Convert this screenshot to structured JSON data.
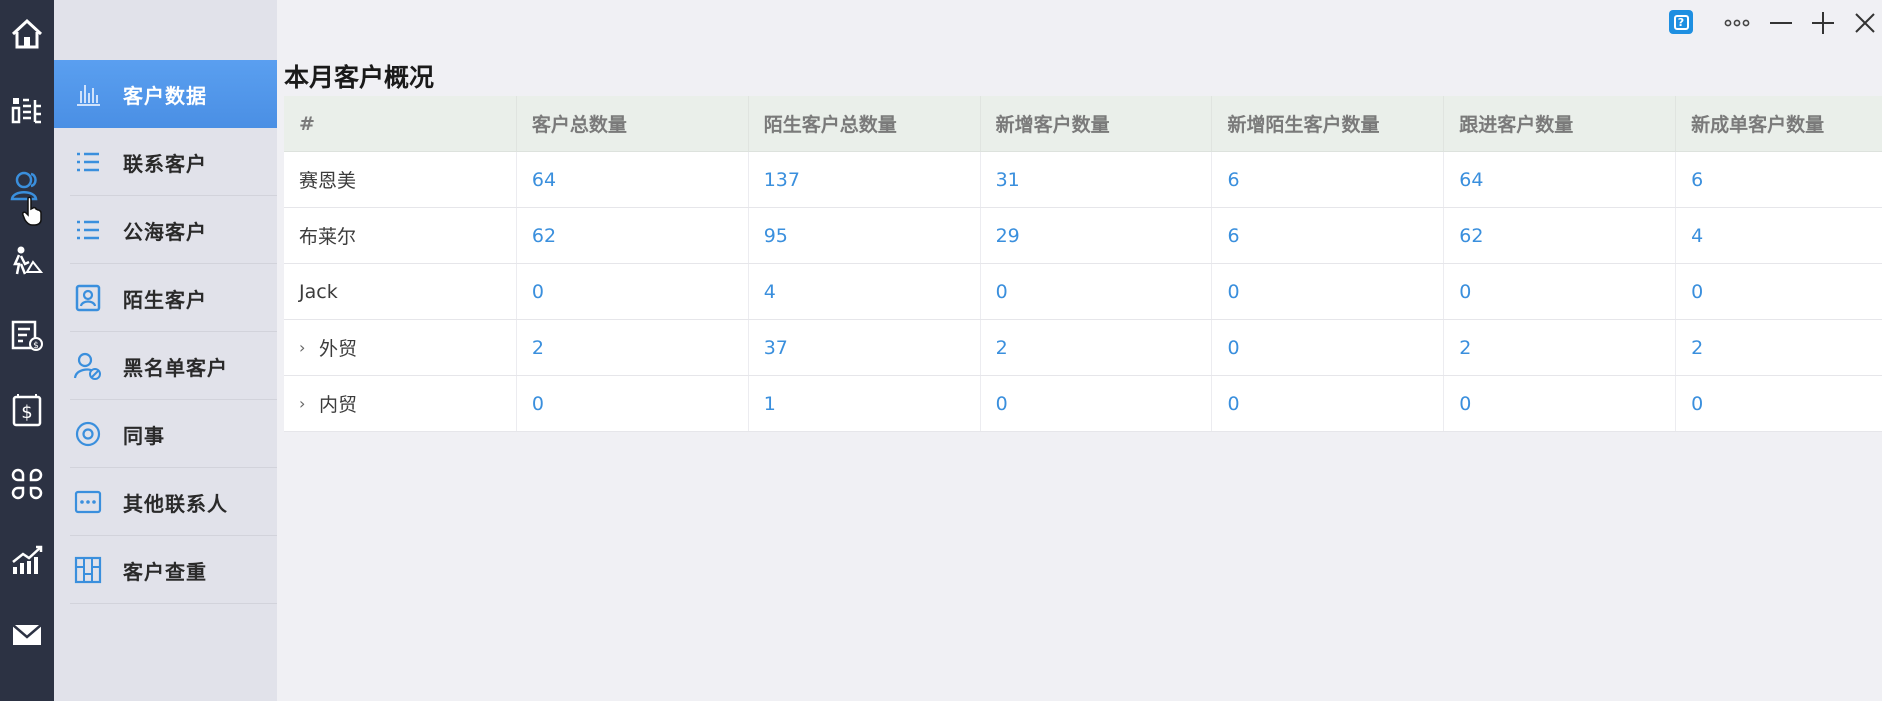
{
  "rail": {
    "icons": [
      "home-icon",
      "org-chart-icon",
      "customers-icon",
      "field-work-icon",
      "invoice-icon",
      "dollar-icon",
      "apps-icon",
      "analytics-icon",
      "mail-icon"
    ]
  },
  "sidebar": {
    "items": [
      {
        "label": "客户数据",
        "icon": "bar-chart-icon",
        "active": true
      },
      {
        "label": "联系客户",
        "icon": "list-icon"
      },
      {
        "label": "公海客户",
        "icon": "list-icon"
      },
      {
        "label": "陌生客户",
        "icon": "contact-card-icon"
      },
      {
        "label": "黑名单客户",
        "icon": "blocked-user-icon"
      },
      {
        "label": "同事",
        "icon": "target-icon"
      },
      {
        "label": "其他联系人",
        "icon": "more-dots-icon"
      },
      {
        "label": "客户查重",
        "icon": "grid-icon"
      }
    ]
  },
  "window": {
    "help_label": "?",
    "more_label": "•••",
    "minimize_label": "—",
    "maximize_label": "+",
    "close_label": "×"
  },
  "main": {
    "title": "本月客户概况",
    "table": {
      "headers": [
        "#",
        "客户总数量",
        "陌生客户总数量",
        "新增客户数量",
        "新增陌生客户数量",
        "跟进客户数量",
        "新成单客户数量"
      ],
      "rows": [
        {
          "name": "赛恩美",
          "expandable": false,
          "values": [
            "64",
            "137",
            "31",
            "6",
            "64",
            "6"
          ]
        },
        {
          "name": "布莱尔",
          "expandable": false,
          "values": [
            "62",
            "95",
            "29",
            "6",
            "62",
            "4"
          ]
        },
        {
          "name": "Jack",
          "expandable": false,
          "values": [
            "0",
            "4",
            "0",
            "0",
            "0",
            "0"
          ]
        },
        {
          "name": "外贸",
          "expandable": true,
          "values": [
            "2",
            "37",
            "2",
            "0",
            "2",
            "2"
          ]
        },
        {
          "name": "内贸",
          "expandable": true,
          "values": [
            "0",
            "1",
            "0",
            "0",
            "0",
            "0"
          ]
        }
      ]
    }
  },
  "colors": {
    "rail_bg": "#2c3243",
    "sidebar_bg": "#e1e2ea",
    "active_item": "#4a8fe4",
    "icon_blue": "#3a8fdd",
    "number_blue": "#3a8fdd"
  }
}
